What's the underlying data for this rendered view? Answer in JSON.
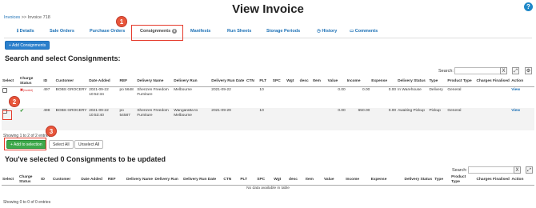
{
  "page": {
    "title": "View Invoice",
    "help": "?"
  },
  "breadcrumb": {
    "link": "Invoices",
    "sep": ">>",
    "current": "Invoice 718"
  },
  "tabs": [
    {
      "label": "Details",
      "icon": "info-icon"
    },
    {
      "label": "Sale Orders"
    },
    {
      "label": "Purchase Orders"
    },
    {
      "label": "Consignments",
      "badge": "0",
      "active": true
    },
    {
      "label": "Manifests"
    },
    {
      "label": "Run Sheets"
    },
    {
      "label": "Storage Periods"
    },
    {
      "label": "History",
      "icon": "clock-icon"
    },
    {
      "label": "Comments",
      "icon": "comment-icon"
    }
  ],
  "add_consignments": "+ Add Consignments",
  "section1": {
    "title": "Search and select Consignments:",
    "search_label": "Search:",
    "clear": "X",
    "columns": [
      "Select",
      "Charge Status",
      "ID",
      "Customer",
      "Date Added",
      "REF",
      "Delivery Name",
      "Delivery Run",
      "Delivery Run Date",
      "CTN",
      "PLT",
      "SPC",
      "Wgt",
      "desc",
      "Item",
      "Value",
      "Income",
      "Expense",
      "Delivery Status",
      "Type",
      "Product Type",
      "Charges Finalised",
      "Action"
    ],
    "rows": [
      {
        "charge_status": "✖",
        "charge_note": "(invalid)",
        "id": "497",
        "customer": "BOBS GROCERY",
        "date": "2021-09-22 10:52:34",
        "ref": "po 5648",
        "delivery_name": "Shenzen Freedom Furniture",
        "run": "Melbourne",
        "run_date": "2021-09-22",
        "ctn": "",
        "plt": "10",
        "spc": "",
        "wgt": "",
        "desc": "",
        "item": "",
        "value": "0.00",
        "income": "0.00",
        "expense": "0.00",
        "status": "In Warehouse",
        "type": "Delivery",
        "product_type": "General",
        "finalised": "",
        "action": "View"
      },
      {
        "charge_status": "✔",
        "charge_note": "",
        "id": "498",
        "customer": "BOBS GROCERY",
        "date": "2021-09-22 10:53:40",
        "ref": "po 54587",
        "delivery_name": "Shenzen Freedom Furniture",
        "run": "Wangaratta to Melbourne",
        "run_date": "2021-09-29",
        "ctn": "",
        "plt": "10",
        "spc": "",
        "wgt": "",
        "desc": "",
        "item": "",
        "value": "0.00",
        "income": "650.00",
        "expense": "0.00",
        "status": "Awaiting Pickup",
        "type": "Pickup",
        "product_type": "General",
        "finalised": "",
        "action": "View"
      }
    ],
    "showing": "Showing 1 to 2 of 2 entries",
    "add_to_selection": "+ Add to selection",
    "select_all": "Select All",
    "unselect_all": "Unselect All"
  },
  "section2": {
    "title": "You've selected 0 Consignments to be updated",
    "search_label": "Search:",
    "clear": "X",
    "columns": [
      "Select",
      "Charge Status",
      "ID",
      "Customer",
      "Date Added",
      "REF",
      "Delivery Name",
      "Delivery Run",
      "Delivery Run Date",
      "CTN",
      "PLT",
      "SPC",
      "Wgt",
      "desc",
      "Item",
      "Value",
      "Income",
      "Expense",
      "Delivery Status",
      "Type",
      "Product Type",
      "Charges Finalised",
      "Action"
    ],
    "empty": "No data available in table",
    "showing": "Showing 0 to 0 of 0 entries"
  },
  "annotations": [
    "1",
    "2",
    "3"
  ],
  "colors": {
    "accent": "#2a7fcc",
    "green": "#3da84a",
    "highlight": "#e53b2c"
  }
}
